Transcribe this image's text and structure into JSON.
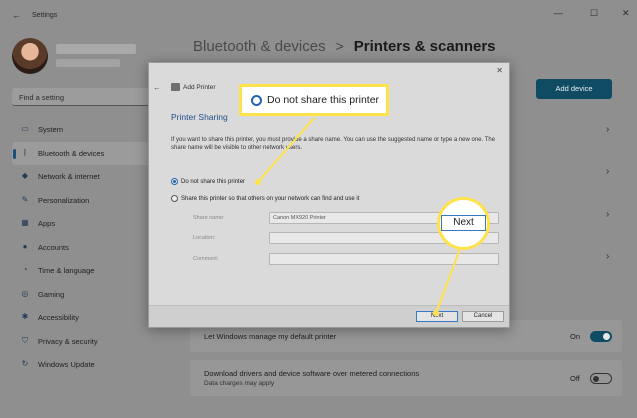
{
  "window": {
    "title": "Settings",
    "back_glyph": "←",
    "minimize_glyph": "—",
    "maximize_glyph": "☐",
    "close_glyph": "✕"
  },
  "search": {
    "placeholder": "Find a setting",
    "icon": "search-icon"
  },
  "sidebar": {
    "items": [
      {
        "label": "System",
        "icon": "monitor-icon",
        "glyph": "▭"
      },
      {
        "label": "Bluetooth & devices",
        "icon": "bluetooth-icon",
        "glyph": "ᛒ"
      },
      {
        "label": "Network & internet",
        "icon": "wifi-icon",
        "glyph": "◆"
      },
      {
        "label": "Personalization",
        "icon": "brush-icon",
        "glyph": "✎"
      },
      {
        "label": "Apps",
        "icon": "apps-icon",
        "glyph": "▦"
      },
      {
        "label": "Accounts",
        "icon": "person-icon",
        "glyph": "●"
      },
      {
        "label": "Time & language",
        "icon": "globe-icon",
        "glyph": "◔"
      },
      {
        "label": "Gaming",
        "icon": "controller-icon",
        "glyph": "◎"
      },
      {
        "label": "Accessibility",
        "icon": "accessibility-icon",
        "glyph": "✱"
      },
      {
        "label": "Privacy & security",
        "icon": "shield-icon",
        "glyph": "⛉"
      },
      {
        "label": "Windows Update",
        "icon": "update-icon",
        "glyph": "↻"
      }
    ]
  },
  "header": {
    "breadcrumb_parent": "Bluetooth & devices",
    "breadcrumb_separator": ">",
    "breadcrumb_current": "Printers & scanners"
  },
  "main": {
    "add_device_label": "Add device",
    "chevron_glyph": "›",
    "default_printer_label": "Let Windows manage my default printer",
    "default_printer_state": "On",
    "metered_label": "Download drivers and device software over metered connections",
    "metered_sub": "Data charges may apply",
    "metered_state": "Off"
  },
  "dialog": {
    "title": "Add Printer",
    "heading": "Printer Sharing",
    "description": "If you want to share this printer, you must provide a share name. You can use the suggested name or type a new one. The share name will be visible to other network users.",
    "option_no_share": "Do not share this printer",
    "option_share": "Share this printer so that others on your network can find and use it",
    "share_name_label": "Share name:",
    "share_name_value": "Canon MX920 Printer",
    "location_label": "Location:",
    "comment_label": "Comment:",
    "next_label": "Next",
    "cancel_label": "Cancel",
    "close_glyph": "✕",
    "back_glyph": "←"
  },
  "callouts": {
    "radio_text": "Do not share this printer",
    "next_text": "Next",
    "highlight_color": "#ffe24a"
  }
}
